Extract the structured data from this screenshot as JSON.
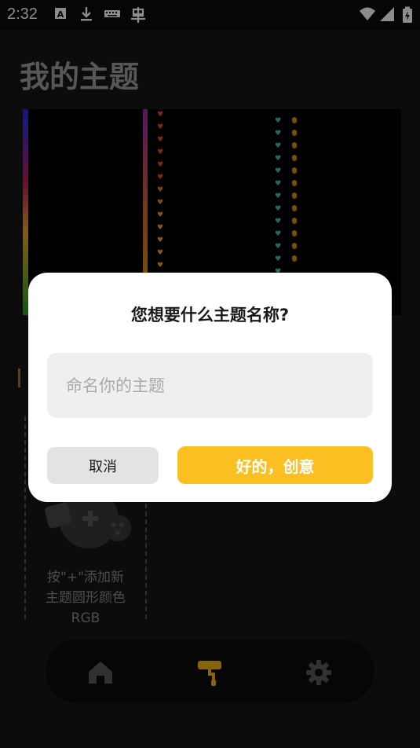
{
  "status_bar": {
    "time": "2:32",
    "icons": [
      "text-a-icon",
      "download-icon",
      "keyboard-icon",
      "bug-icon",
      "wifi-icon",
      "signal-icon",
      "battery-charging-icon"
    ]
  },
  "page": {
    "title": "我的主题",
    "add_card_text": "按\"+\"添加新\n主题圆形颜色\nRGB"
  },
  "bottom_nav": {
    "items": [
      "home-icon",
      "theme-roller-icon",
      "settings-icon"
    ],
    "active_color": "#f5b90f",
    "inactive_color": "#5a5a5a"
  },
  "dialog": {
    "title": "您想要什么主题名称?",
    "input_placeholder": "命名你的主题",
    "input_value": "",
    "cancel_label": "取消",
    "confirm_label": "好的，创意"
  },
  "colors": {
    "accent": "#fbbf22",
    "background": "#161616",
    "dialog_bg": "#ffffff"
  }
}
